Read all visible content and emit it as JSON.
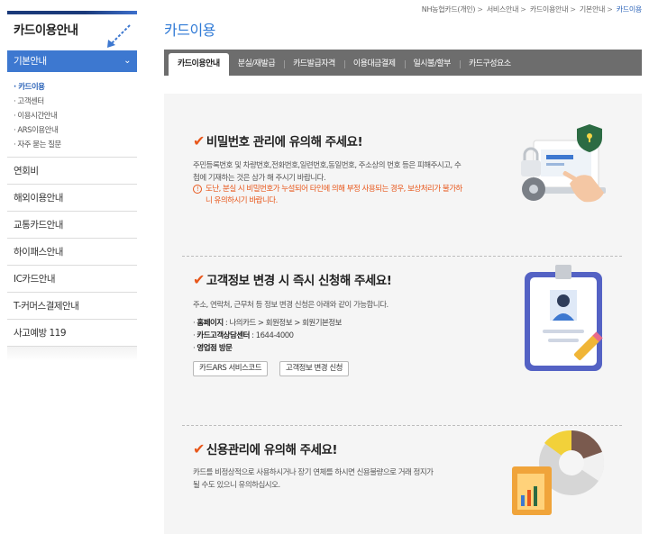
{
  "sidebar": {
    "title": "카드이용안내",
    "active_menu": "기본안내",
    "sub_items": [
      "· 카드이용",
      "· 고객센터",
      "· 이용시간안내",
      "· ARS이용안내",
      "· 자주 묻는 질문"
    ],
    "items": [
      "연회비",
      "해외이용안내",
      "교통카드안내",
      "하이패스안내",
      "IC카드안내",
      "T-커머스결제안내",
      "사고예방 119"
    ]
  },
  "breadcrumb": [
    "NH농협카드(개인)",
    "서비스안내",
    "카드이용안내",
    "기본안내",
    "카드이용"
  ],
  "page_title": "카드이용",
  "tabs": [
    "카드이용안내",
    "분실/재발급",
    "카드발급자격",
    "이용대금결제",
    "일시불/할부",
    "카드구성요소"
  ],
  "sections": {
    "password": {
      "title": "비밀번호 관리에 유의해 주세요!",
      "text": "주민등록번호 및 차량번호,전화번호,일련번호,동일번호, 주소상의 번호 등은 피해주시고, 수첩에 기재하는 것은 삼가 해 주시기 바랍니다.",
      "warning": "도난, 분실 시 비밀번호가 누설되어 타인에 의해 부정 사용되는 경우, 보상처리가 불가하니 유의하시기 바랍니다."
    },
    "customer_info": {
      "title": "고객정보 변경 시 즉시 신청해 주세요!",
      "text": "주소, 연락처, 근무처 등 정보 변경 신청은 아래와 같이 가능합니다.",
      "bullets": [
        {
          "label": "홈페이지",
          "value": " : 나의카드 > 회원정보 > 회원기본정보"
        },
        {
          "label": "카드고객상담센터",
          "value": " : 1644-4000"
        },
        {
          "label": "영업점 방문",
          "value": ""
        }
      ],
      "buttons": [
        "카드ARS 서비스코드",
        "고객정보 변경 신청"
      ]
    },
    "credit": {
      "title": "신용관리에 유의해 주세요!",
      "text": "카드를 비정상적으로 사용하시거나 장기 연체를 하시면 신용불량으로 거래 정지가 될 수도 있으니 유의하십시오."
    }
  },
  "colors": {
    "accent_blue": "#2f7ad6",
    "sidebar_active": "#3d78d0",
    "tab_bar": "#6d6d6d",
    "check_orange": "#e8571b"
  },
  "icons": [
    "check-icon",
    "warning-icon",
    "chevron-down-icon",
    "pointer-arrow-icon",
    "security-laptop-illustration",
    "id-card-illustration",
    "pie-chart-illustration"
  ]
}
